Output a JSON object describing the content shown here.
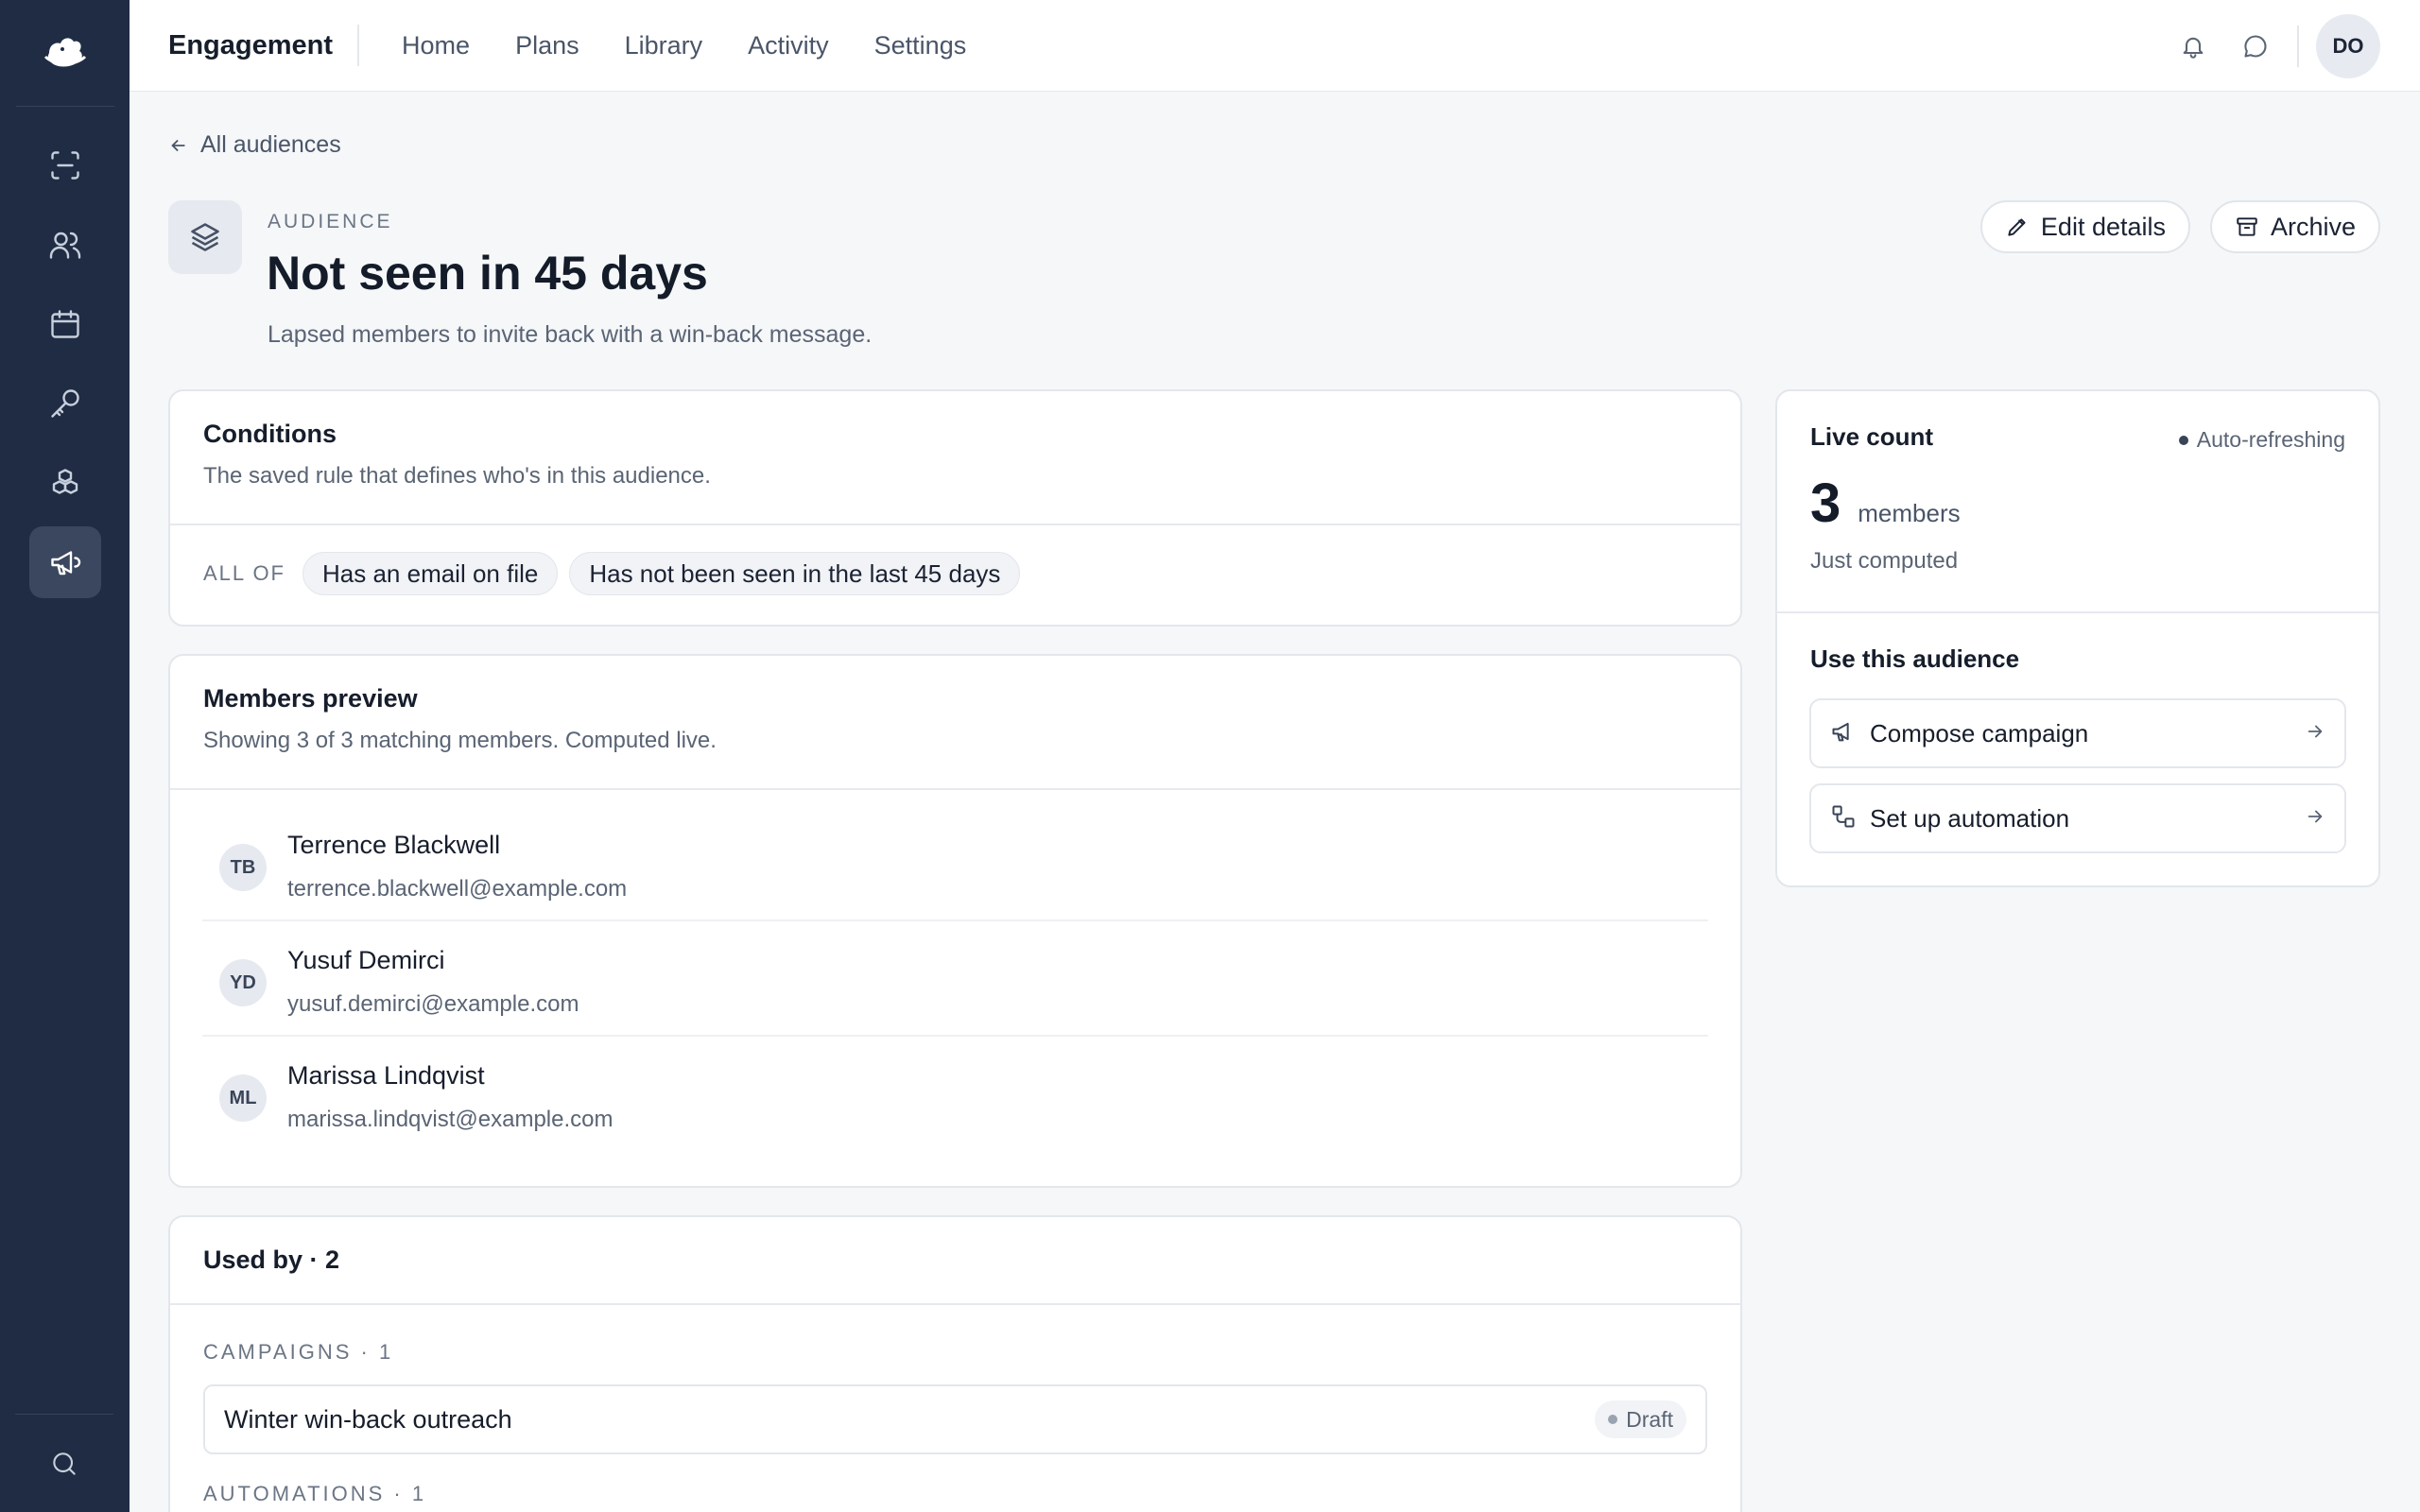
{
  "app": {
    "brand": "Engagement",
    "nav": [
      "Home",
      "Plans",
      "Library",
      "Activity",
      "Settings"
    ],
    "user_initials": "DO"
  },
  "sidebar": {
    "icons": [
      "logo-icon",
      "scan-icon",
      "users-icon",
      "calendar-icon",
      "key-icon",
      "boxes-icon",
      "megaphone-icon",
      "search-icon"
    ],
    "active": "megaphone-icon"
  },
  "back_link": "All audiences",
  "header": {
    "eyebrow": "AUDIENCE",
    "title": "Not seen in 45 days",
    "subtitle": "Lapsed members to invite back with a win-back message.",
    "edit_label": "Edit details",
    "archive_label": "Archive"
  },
  "conditions": {
    "title": "Conditions",
    "subtitle": "The saved rule that defines who's in this audience.",
    "match_label": "ALL OF",
    "rules": [
      "Has an email on file",
      "Has not been seen in the last 45 days"
    ]
  },
  "members": {
    "title": "Members preview",
    "subtitle": "Showing 3 of 3 matching members. Computed live.",
    "list": [
      {
        "initials": "TB",
        "name": "Terrence Blackwell",
        "email": "terrence.blackwell@example.com"
      },
      {
        "initials": "YD",
        "name": "Yusuf Demirci",
        "email": "yusuf.demirci@example.com"
      },
      {
        "initials": "ML",
        "name": "Marissa Lindqvist",
        "email": "marissa.lindqvist@example.com"
      }
    ]
  },
  "used_by": {
    "title": "Used by · 2",
    "campaigns_label": "CAMPAIGNS · 1",
    "campaigns": [
      {
        "name": "Winter win-back outreach",
        "status": "Draft"
      }
    ],
    "automations_label": "AUTOMATIONS · 1"
  },
  "live_count": {
    "title": "Live count",
    "status": "Auto-refreshing",
    "count": "3",
    "unit": "members",
    "computed": "Just computed"
  },
  "use_audience": {
    "title": "Use this audience",
    "actions": [
      "Compose campaign",
      "Set up automation"
    ]
  },
  "colors": {
    "sidebar": "#1f2c44",
    "background": "#f5f7f9",
    "card": "#ffffff"
  }
}
